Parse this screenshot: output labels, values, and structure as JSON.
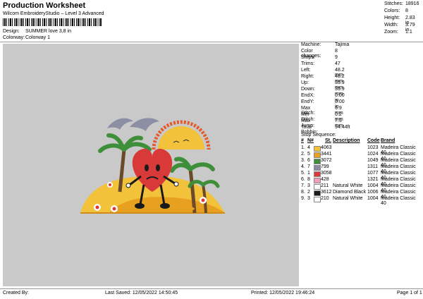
{
  "header": {
    "title": "Production Worksheet",
    "subtitle": "Wilcom EmbroideryStudio – Level 3 Advanced",
    "design_label": "Design:",
    "design_value": "SUMMER love 3,8 in",
    "colorway_label": "Colorway:",
    "colorway_value": "Colorway 1"
  },
  "summary": [
    {
      "label": "Stitches:",
      "value": "18916"
    },
    {
      "label": "Colors:",
      "value": "8"
    },
    {
      "label": "Height:",
      "value": "2.83 in"
    },
    {
      "label": "Width:",
      "value": "3.79 in"
    },
    {
      "label": "Zoom:",
      "value": "1:1"
    }
  ],
  "machine_info": [
    {
      "label": "Machine:",
      "value": "Tajima"
    },
    {
      "label": "Color changes:",
      "value": "8"
    },
    {
      "label": "Stops:",
      "value": "9"
    },
    {
      "label": "Trims:",
      "value": "47"
    },
    {
      "label": "Left:",
      "value": "48.2 mm"
    },
    {
      "label": "Right:",
      "value": "48.2 mm"
    },
    {
      "label": "Up:",
      "value": "35.9 mm"
    },
    {
      "label": "Down:",
      "value": "35.9 mm"
    },
    {
      "label": "EndX:",
      "value": "0.00 in"
    },
    {
      "label": "EndY:",
      "value": "0.00 in"
    },
    {
      "label": "Max Stitch:",
      "value": "6.9 mm"
    },
    {
      "label": "Min Stitch:",
      "value": "0.2 mm"
    },
    {
      "label": "Max Jump:",
      "value": "7.3 mm"
    },
    {
      "label": "Total Bobbin:",
      "value": "94.44ft"
    }
  ],
  "stop_sequence": {
    "heading": "Stop Sequence:",
    "columns": {
      "num": "#",
      "n": "N#",
      "st": "St.",
      "desc": "Description",
      "code": "Code",
      "brand": "Brand"
    },
    "rows": [
      {
        "num": "1.",
        "n": "4",
        "color": "#f2c23a",
        "st": "4063",
        "desc": "",
        "code": "1023",
        "brand": "Madeira Classic 40"
      },
      {
        "num": "2.",
        "n": "5",
        "color": "#e8a020",
        "st": "3441",
        "desc": "",
        "code": "1024",
        "brand": "Madeira Classic 40"
      },
      {
        "num": "3.",
        "n": "6",
        "color": "#3f8f3a",
        "st": "3072",
        "desc": "",
        "code": "1049",
        "brand": "Madeira Classic 40"
      },
      {
        "num": "4.",
        "n": "7",
        "color": "#8a8aa0",
        "st": "799",
        "desc": "",
        "code": "1311",
        "brand": "Madeira Classic 40"
      },
      {
        "num": "5.",
        "n": "1",
        "color": "#d83a3a",
        "st": "3058",
        "desc": "",
        "code": "1077",
        "brand": "Madeira Classic 40"
      },
      {
        "num": "6.",
        "n": "8",
        "color": "#f2a0b8",
        "st": "428",
        "desc": "",
        "code": "1321",
        "brand": "Madeira Classic 40"
      },
      {
        "num": "7.",
        "n": "3",
        "color": "#ffffff",
        "st": "211",
        "desc": "Natural White",
        "code": "1004",
        "brand": "Madeira Classic 40"
      },
      {
        "num": "8.",
        "n": "2",
        "color": "#1a1a1a",
        "st": "3612",
        "desc": "Diamond Black",
        "code": "1006",
        "brand": "Madeira Classic 40"
      },
      {
        "num": "9.",
        "n": "3",
        "color": "#ffffff",
        "st": "210",
        "desc": "Natural White",
        "code": "1004",
        "brand": "Madeira Classic 40"
      }
    ]
  },
  "footer": {
    "created_by": "Created By:",
    "last_saved": "Last Saved: 12/05/2022 14:50:45",
    "printed": "Printed: 12/05/2022 19:46:24",
    "page": "Page 1 of 1"
  }
}
